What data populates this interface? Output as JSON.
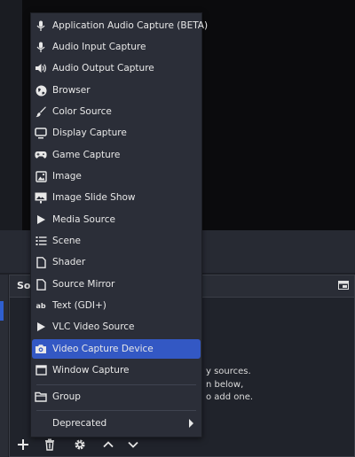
{
  "sources_dock": {
    "title": "So",
    "hint_lines": [
      "y sources.",
      "n below,",
      "o add one."
    ]
  },
  "menu": {
    "items": [
      {
        "label": "Application Audio Capture (BETA)",
        "icon": "microphone-icon"
      },
      {
        "label": "Audio Input Capture",
        "icon": "microphone-icon"
      },
      {
        "label": "Audio Output Capture",
        "icon": "speaker-icon"
      },
      {
        "label": "Browser",
        "icon": "globe-icon"
      },
      {
        "label": "Color Source",
        "icon": "brush-icon"
      },
      {
        "label": "Display Capture",
        "icon": "monitor-icon"
      },
      {
        "label": "Game Capture",
        "icon": "gamepad-icon"
      },
      {
        "label": "Image",
        "icon": "image-icon"
      },
      {
        "label": "Image Slide Show",
        "icon": "slideshow-icon"
      },
      {
        "label": "Media Source",
        "icon": "play-icon"
      },
      {
        "label": "Scene",
        "icon": "list-icon"
      },
      {
        "label": "Shader",
        "icon": "file-icon"
      },
      {
        "label": "Source Mirror",
        "icon": "file-icon"
      },
      {
        "label": "Text (GDI+)",
        "icon": "text-icon",
        "icon_text": "ab"
      },
      {
        "label": "VLC Video Source",
        "icon": "play-icon"
      },
      {
        "label": "Video Capture Device",
        "icon": "camera-icon",
        "selected": true
      },
      {
        "label": "Window Capture",
        "icon": "window-icon"
      },
      {
        "label": "Group",
        "icon": "folder-icon"
      },
      {
        "label": "Deprecated",
        "icon": "none"
      }
    ]
  },
  "toolbar": {
    "buttons": [
      "add-icon",
      "trash-icon",
      "gear-icon",
      "chevron-up-icon",
      "chevron-down-icon"
    ]
  },
  "colors": {
    "selected": "#3358c4",
    "menu_bg": "#2b2e38",
    "window_bg": "#1d1f26"
  }
}
